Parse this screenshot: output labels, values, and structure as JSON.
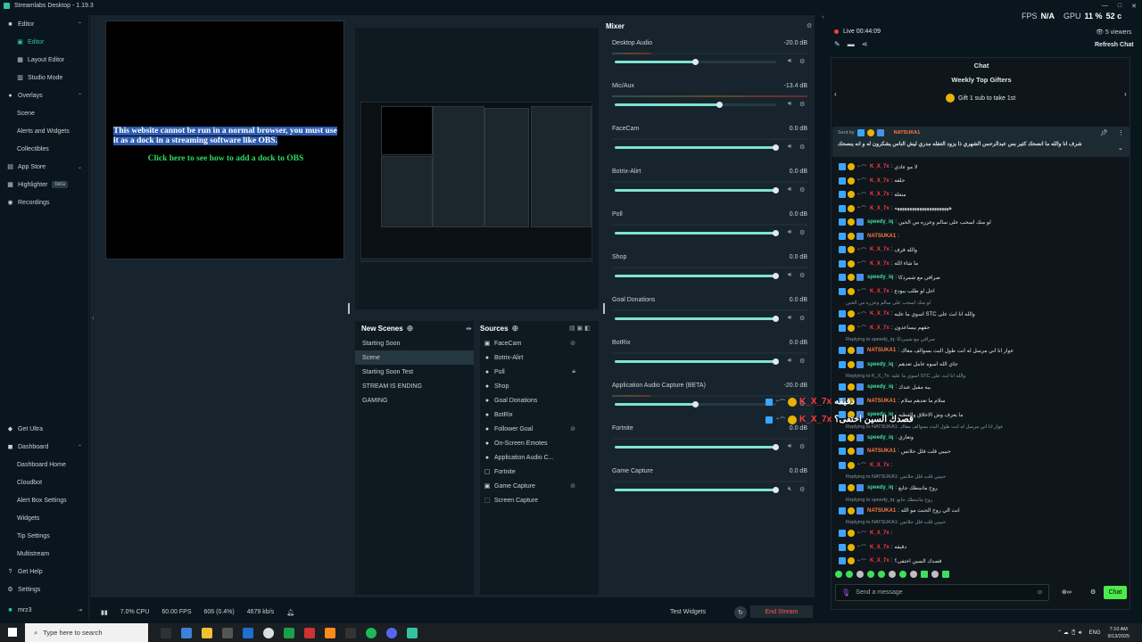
{
  "window": {
    "title": "Streamlabs Desktop - 1.19.3",
    "controls": [
      "—",
      "□",
      "✕"
    ]
  },
  "sidebar": {
    "top": [
      {
        "label": "Editor",
        "icon": "■",
        "chev": "⌃",
        "kind": "head"
      },
      {
        "label": "Editor",
        "icon": "▣",
        "kind": "sub",
        "active": true
      },
      {
        "label": "Layout Editor",
        "icon": "▦",
        "kind": "sub"
      },
      {
        "label": "Studio Mode",
        "icon": "▥",
        "kind": "sub"
      },
      {
        "label": "Overlays",
        "icon": "●",
        "chev": "⌃",
        "kind": "head"
      },
      {
        "label": "Scene",
        "kind": "sub"
      },
      {
        "label": "Alerts and Widgets",
        "kind": "sub"
      },
      {
        "label": "Collectibles",
        "kind": "sub"
      },
      {
        "label": "App Store",
        "icon": "▤",
        "chev": "⌄",
        "kind": "head"
      },
      {
        "label": "Highlighter",
        "icon": "▦",
        "badge": "beta",
        "kind": "head"
      },
      {
        "label": "Recordings",
        "icon": "◉",
        "kind": "head"
      }
    ],
    "bottom": [
      {
        "label": "Get Ultra",
        "icon": "◆",
        "kind": "head"
      },
      {
        "label": "Dashboard",
        "icon": "◼",
        "chev": "⌃",
        "kind": "head"
      },
      {
        "label": "Dashboard Home",
        "kind": "sub"
      },
      {
        "label": "Cloudbot",
        "kind": "sub"
      },
      {
        "label": "Alert Box Settings",
        "kind": "sub"
      },
      {
        "label": "Widgets",
        "kind": "sub"
      },
      {
        "label": "Tip Settings",
        "kind": "sub"
      },
      {
        "label": "Multistream",
        "kind": "sub"
      },
      {
        "label": "Get Help",
        "icon": "?",
        "kind": "head"
      },
      {
        "label": "Settings",
        "icon": "⚙",
        "kind": "head"
      }
    ],
    "user": {
      "name": "mrz3",
      "logout": "⇥"
    }
  },
  "browser_dock": {
    "message": "This website cannot be run in a normal browser, you must use it as a dock in a streaming software like OBS.",
    "link": "Click here to see how to add a dock to OBS"
  },
  "scenes": {
    "title": "New Scenes",
    "items": [
      "Starting Soon",
      "Scene",
      "Starting Soon Test",
      "STREAM IS ENDING",
      "GAMING"
    ],
    "selected": "Scene"
  },
  "sources": {
    "title": "Sources",
    "items": [
      {
        "label": "FaceCam",
        "icon": "▣",
        "hidden": true
      },
      {
        "label": "Botrix-Alirt",
        "icon": "●"
      },
      {
        "label": "Poll",
        "icon": "●",
        "locked": true
      },
      {
        "label": "Shop",
        "icon": "●"
      },
      {
        "label": "Goal Donations",
        "icon": "●"
      },
      {
        "label": "BotRix",
        "icon": "●"
      },
      {
        "label": "Follower Goal",
        "icon": "●",
        "hidden": true
      },
      {
        "label": "On-Screen Emotes",
        "icon": "●"
      },
      {
        "label": "Application Audio C...",
        "icon": "●"
      },
      {
        "label": "Fortnite",
        "icon": "▢"
      },
      {
        "label": "Game Capture",
        "icon": "▣",
        "hidden": true
      },
      {
        "label": "Screen Capture",
        "icon": "⬚"
      }
    ]
  },
  "mixer": {
    "title": "Mixer",
    "items": [
      {
        "name": "Desktop Audio",
        "db": "-20.0 dB",
        "level": 0.5,
        "muted": false
      },
      {
        "name": "Mic/Aux",
        "db": "-13.4 dB",
        "level": 0.65,
        "muted": false
      },
      {
        "name": "FaceCam",
        "db": "0.0 dB",
        "level": 1,
        "muted": false
      },
      {
        "name": "Botrix-Alirt",
        "db": "0.0 dB",
        "level": 1,
        "muted": false
      },
      {
        "name": "Poll",
        "db": "0.0 dB",
        "level": 1,
        "muted": false
      },
      {
        "name": "Shop",
        "db": "0.0 dB",
        "level": 1,
        "muted": false
      },
      {
        "name": "Goal Donations",
        "db": "0.0 dB",
        "level": 1,
        "muted": false
      },
      {
        "name": "BotRix",
        "db": "0.0 dB",
        "level": 1,
        "muted": false
      },
      {
        "name": "Application Audio Capture (BETA)",
        "db": "-20.0 dB",
        "level": 0.5,
        "muted": false
      },
      {
        "name": "Fortnite",
        "db": "0.0 dB",
        "level": 1,
        "muted": false
      },
      {
        "name": "Game Capture",
        "db": "0.0 dB",
        "level": 1,
        "muted": true
      }
    ]
  },
  "status": {
    "cpu": "7.0% CPU",
    "fps": "60.00 FPS",
    "dropped": "606 (0.4%)",
    "bitrate": "4679 kb/s",
    "test_widgets": "Test Widgets",
    "end_stream": "End Stream"
  },
  "perf": {
    "fps_label": "FPS",
    "fps_value": "N/A",
    "gpu_label": "GPU",
    "gpu_value": "11 %",
    "temp": "52 c"
  },
  "live": {
    "label": "Live 00:44:09",
    "viewers": "5 viewers",
    "refresh": "Refresh Chat"
  },
  "chat": {
    "title": "Chat",
    "top_gifters": "Weekly Top Gifters",
    "gift_cta": "Gift 1 sub to take 1st",
    "pinned": {
      "by": "Sent by",
      "user": "NATSUKA1",
      "text": "شرف انا والله ما انصحك كثير بس عبدالرحمن الشهري ذا يزود العقله مدري ليش الناس يشكرون له و انه ينصحك"
    },
    "lines": [
      {
        "user": "K_X_7x",
        "color": "#ff3b3b",
        "text": "لا مو عادي"
      },
      {
        "user": "K_X_7x",
        "color": "#ff3b3b",
        "text": "حلقه"
      },
      {
        "user": "K_X_7x",
        "color": "#ff3b3b",
        "text": "منعلة"
      },
      {
        "user": "K_X_7x",
        "color": "#ff3b3b",
        "text": "ههههههههههههههههههههههه"
      },
      {
        "user": "speedy_iq",
        "color": "#3ee0a0",
        "text": "لو منك اسحب على سالم وعزره من الحين"
      },
      {
        "user": "NATSUKA1",
        "color": "#ff7a3d",
        "text": ""
      },
      {
        "user": "K_X_7x",
        "color": "#ff3b3b",
        "text": "والله قرف"
      },
      {
        "user": "K_X_7x",
        "color": "#ff3b3b",
        "text": "ما شاء الله"
      },
      {
        "user": "speedy_iq",
        "color": "#3ee0a0",
        "text": "صرافي مع شمردكا"
      },
      {
        "user": "K_X_7x",
        "color": "#ff3b3b",
        "text": "اجل لو طلب يبودع"
      },
      {
        "reply": "لو منك اسحب على سالم وعزره من الحين"
      },
      {
        "user": "K_X_7x",
        "color": "#ff3b3b",
        "text": "اسوي ما عليه STC والله انا ابث على"
      },
      {
        "user": "K_X_7x",
        "color": "#ff3b3b",
        "text": "حقهم بيساعدون"
      },
      {
        "reply": "Replying to speedy_iq: صرافي مع شمردكا"
      },
      {
        "user": "NATSUKA1",
        "color": "#ff7a3d",
        "text": "عوار انا اني مرسل له انت طول البث بسوالف معاك"
      },
      {
        "user": "speedy_iq",
        "color": "#3ee0a0",
        "text": "جاي الله اسوه عامل تعدهم"
      },
      {
        "reply": "Replying to K_X_7x: اسوي ما عليه STC والله انا ابث على"
      },
      {
        "user": "speedy_iq",
        "color": "#3ee0a0",
        "text": "يبه مقبل عندك"
      },
      {
        "user": "NATSUKA1",
        "color": "#ff7a3d",
        "text": "سلام ما تعدهم سلام"
      },
      {
        "user": "speedy_iq",
        "color": "#3ee0a0",
        "text": "ما يعرف وش الاخلاق والقطيه"
      },
      {
        "reply": "Replying to NATSUKA1: عوار انا اني مرسل له انت طول البث بسوالف معاك"
      },
      {
        "user": "speedy_iq",
        "color": "#3ee0a0",
        "text": "وتعازي"
      },
      {
        "user": "NATSUKA1",
        "color": "#ff7a3d",
        "text": "حبيبي قلت قلل حلاتس"
      },
      {
        "user": "K_X_7x",
        "color": "#ff3b3b",
        "text": ""
      },
      {
        "reply": "Replying to NATSUKA1: حبيبي قلت قلل حلاتس"
      },
      {
        "user": "speedy_iq",
        "color": "#3ee0a0",
        "text": "روح ماتبنطك جابع"
      },
      {
        "reply": "Replying to speedy_iq: روح ماتبنطك جابع"
      },
      {
        "user": "NATSUKA1",
        "color": "#ff7a3d",
        "text": "انت الي روح الحبث مو الله"
      },
      {
        "reply": "Replying to NATSUKA1: حبيبي قلت قلل حلاتس"
      },
      {
        "user": "K_X_7x",
        "color": "#ff3b3b",
        "text": ""
      },
      {
        "user": "K_X_7x",
        "color": "#ff3b3b",
        "text": "دقيقه"
      },
      {
        "user": "K_X_7x",
        "color": "#ff3b3b",
        "text": "قصدك السين اختفى؟"
      }
    ],
    "overlay_lines": [
      {
        "user": "K_X_7x",
        "text": "دقيقه"
      },
      {
        "user": "K_X_7x",
        "text": "قصدك السين اختفى؟"
      }
    ],
    "input_placeholder": "Send a message",
    "send": "Chat"
  },
  "taskbar": {
    "search": "Type here to search",
    "lang": "ENG",
    "time": "7:10 AM",
    "date": "9/13/2025"
  }
}
